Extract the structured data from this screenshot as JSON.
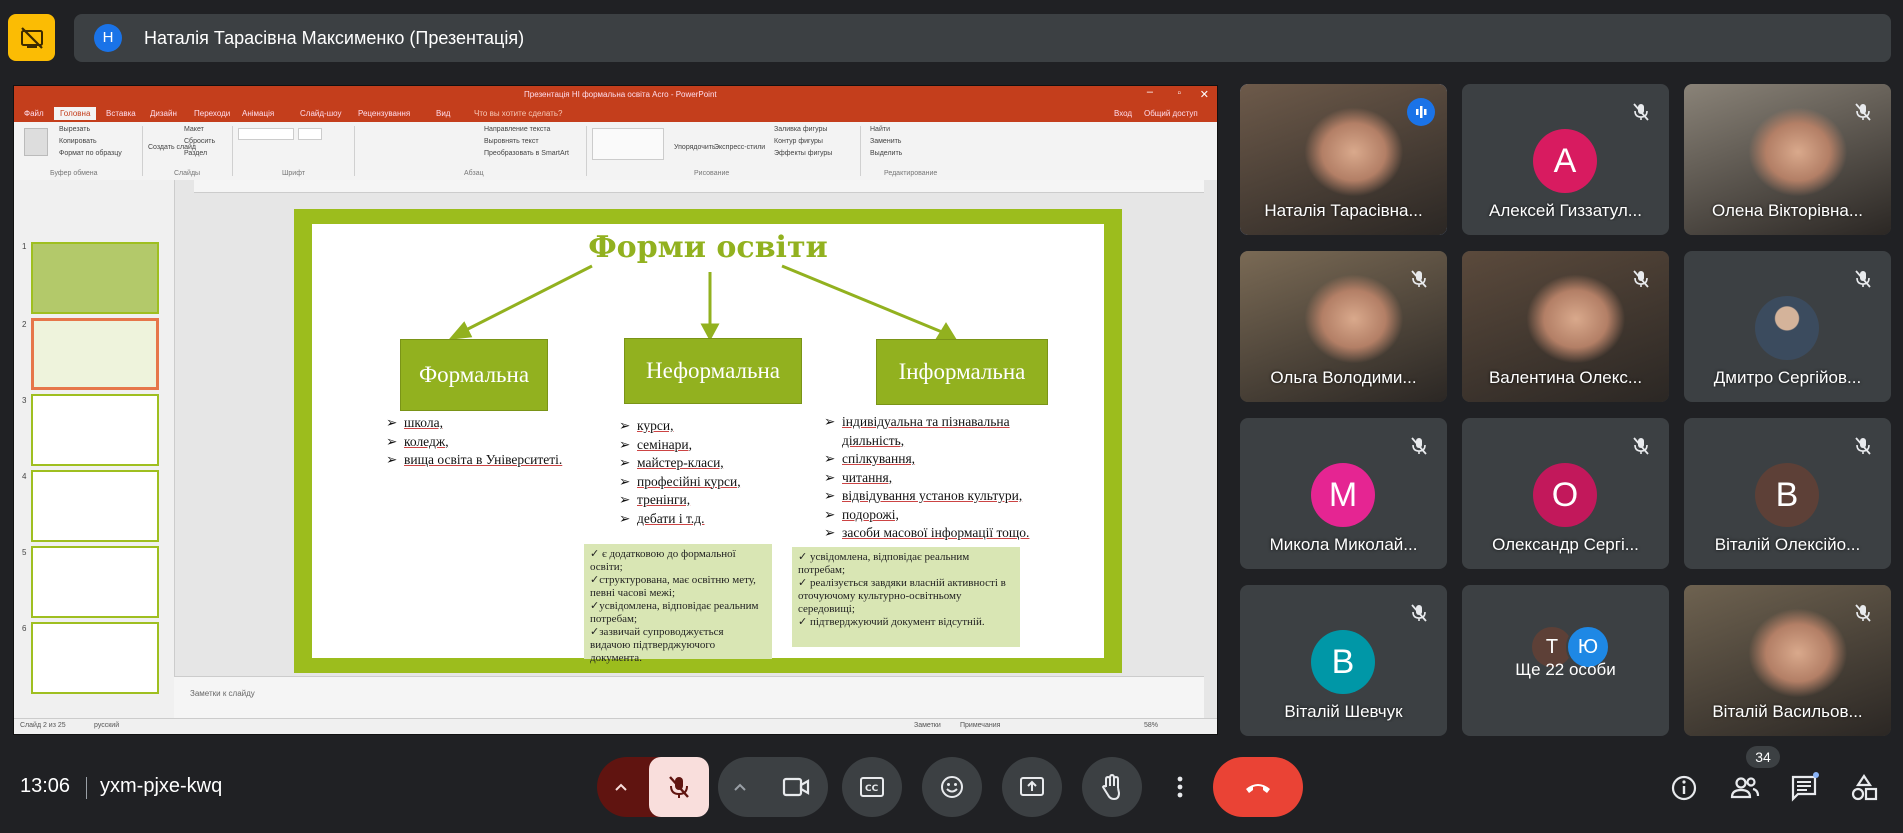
{
  "top_bar": {
    "presenter_initial": "Н",
    "presenter_title": "Наталія Тарасівна Максименко (Презентація)"
  },
  "ppt": {
    "window_title": "Презентація НІ формальна освіта Acro - PowerPoint",
    "tabs": [
      "Файл",
      "Головна",
      "Вставка",
      "Дизайн",
      "Переходи",
      "Анімація",
      "Слайд-шоу",
      "Рецензування",
      "Вид",
      "Что вы хотите сделать?"
    ],
    "tabs_right": [
      "Вход",
      "Общий доступ"
    ],
    "ribbon_buttons": [
      "Вырезать",
      "Копировать",
      "Формат по образцу",
      "Создать слайд",
      "Макет",
      "Сбросить",
      "Раздел",
      "Направление текста",
      "Выровнять текст",
      "Преобразовать в SmartArt",
      "Упорядочить",
      "Экспресс-стили",
      "Заливка фигуры",
      "Контур фигуры",
      "Эффекты фигуры",
      "Найти",
      "Заменить",
      "Выделить"
    ],
    "ribbon_groups": [
      "Буфер обмена",
      "Слайды",
      "Шрифт",
      "Абзац",
      "Рисование",
      "Редактирование"
    ],
    "thumb_numbers": [
      "1",
      "2",
      "3",
      "4",
      "5",
      "6"
    ],
    "notes_placeholder": "Заметки к слайду",
    "status_left": "Слайд 2 из 25",
    "status_lang": "русский",
    "status_notes": "Заметки",
    "status_comments": "Примечания",
    "zoom": "58%"
  },
  "slide": {
    "title": "Форми освіти",
    "boxes": [
      "Формальна",
      "Неформальна",
      "Інформальна"
    ],
    "formal_items": [
      "школа,",
      "коледж,",
      "вища освіта в Університеті."
    ],
    "nonformal_items": [
      "курси,",
      "семінари,",
      "майстер-класи,",
      "професійні курси,",
      "тренінги,",
      "дебати і т.д."
    ],
    "informal_items": [
      "індивідуальна та пізнавальна",
      "діяльність,",
      "спілкування,",
      "читання,",
      "відвідування установ культури,",
      "подорожі,",
      "засоби масової інформації тощо."
    ],
    "nonformal_notes": [
      "✓ є додатковою до формальної освіти;",
      "✓структурована, має освітню мету, певні часові межі;",
      "✓усвідомлена, відповідає реальним потребам;",
      "✓зазвичай супроводжується видачою підтверджуючого документа."
    ],
    "informal_notes": [
      "✓  усвідомлена, відповідає реальним потребам;",
      "✓  реалізується завдяки власній активності в оточуючому культурно-освітньому середовищі;",
      "✓  підтверджуючий документ відсутній."
    ]
  },
  "participants": [
    {
      "name": "Наталія Тарасівна...",
      "type": "video",
      "speaking": true
    },
    {
      "name": "Алексей Гиззатул...",
      "type": "avatar",
      "initial": "А",
      "color": "#d81b60"
    },
    {
      "name": "Олена Вікторівна...",
      "type": "video"
    },
    {
      "name": "Ольга Володими...",
      "type": "video"
    },
    {
      "name": "Валентина Олекс...",
      "type": "video"
    },
    {
      "name": "Дмитро Сергійов...",
      "type": "photo"
    },
    {
      "name": "Микола Миколай...",
      "type": "avatar",
      "initial": "М",
      "color": "#e52592"
    },
    {
      "name": "Олександр Сергі...",
      "type": "avatar",
      "initial": "О",
      "color": "#c2185b"
    },
    {
      "name": "Віталій Олексійо...",
      "type": "avatar",
      "initial": "В",
      "color": "#5d4037"
    },
    {
      "name": "Віталій Шевчук",
      "type": "avatar",
      "initial": "В",
      "color": "#0097a7"
    },
    {
      "name": "Ще 22 особи",
      "type": "more",
      "initials": [
        "Т",
        "Ю"
      ]
    },
    {
      "name": "Віталій Васильов...",
      "type": "video"
    }
  ],
  "bottom_bar": {
    "clock": "13:06",
    "meeting_code": "yxm-pjxe-kwq",
    "people_count": "34"
  },
  "colors": {
    "background": "#202124",
    "tile": "#3c4043",
    "present_button": "#fbbc04",
    "end_call": "#ea4335",
    "mic_off_bg": "#f9dedc",
    "slide_green": "#92b11f"
  }
}
